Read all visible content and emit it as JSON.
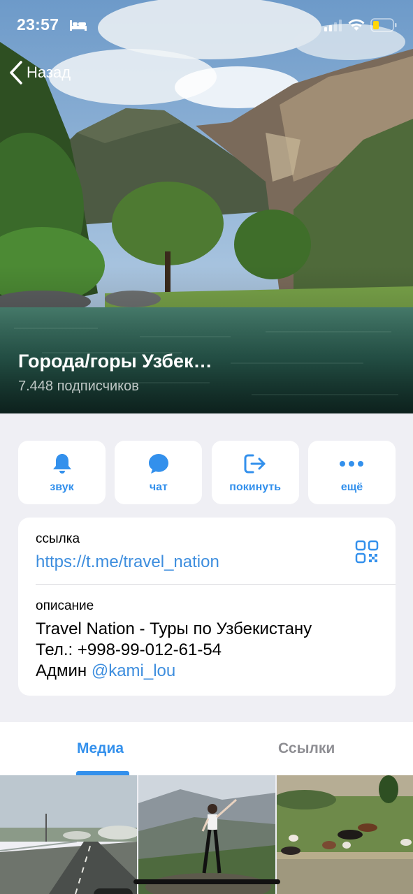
{
  "status_bar": {
    "time": "23:57"
  },
  "nav": {
    "back_label": "Назад"
  },
  "channel": {
    "title": "Города/горы Узбек…",
    "subscribers": "7.448 подписчиков"
  },
  "actions": [
    {
      "label": "звук",
      "icon": "bell-icon"
    },
    {
      "label": "чат",
      "icon": "chat-bubble-icon"
    },
    {
      "label": "покинуть",
      "icon": "leave-icon"
    },
    {
      "label": "ещё",
      "icon": "more-dots-icon"
    }
  ],
  "info": {
    "link_label": "ссылка",
    "link_value": "https://t.me/travel_nation",
    "description_label": "описание",
    "description_line1": "Travel Nation - Туры по Узбекистану",
    "description_line2": "Тел.: +998-99-012-61-54",
    "description_line3_prefix": "Админ",
    "description_mention": "@kami_lou"
  },
  "tabs": [
    {
      "label": "Медиа",
      "active": true
    },
    {
      "label": "Ссылки",
      "active": false
    }
  ],
  "colors": {
    "accent": "#3390ec",
    "link": "#3e8ede",
    "background": "#efeff4"
  }
}
